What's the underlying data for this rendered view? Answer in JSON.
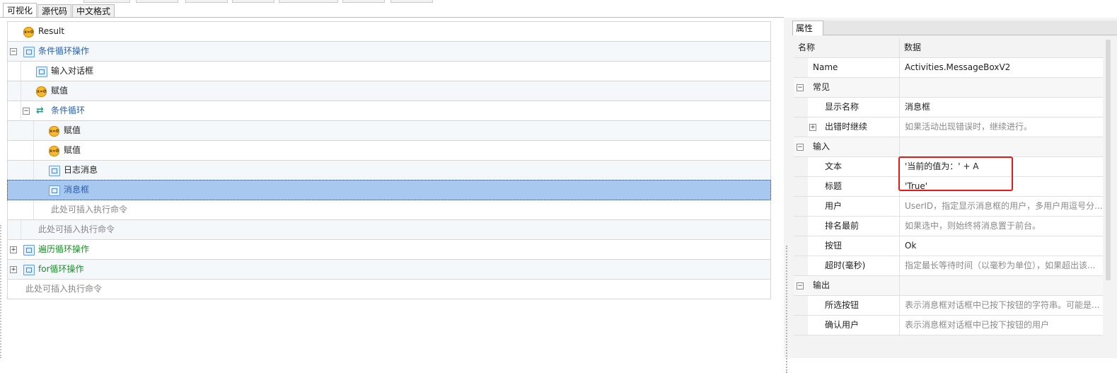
{
  "tabs": [
    "可视化",
    "源代码",
    "中文格式"
  ],
  "tree": {
    "result_label": "Result",
    "rows": [
      {
        "label": "Result",
        "kind": "var",
        "style": "dark"
      },
      {
        "label": "条件循环操作",
        "kind": "act",
        "style": "blue",
        "expander": "−"
      },
      {
        "label": "输入对话框",
        "kind": "act",
        "style": "dark"
      },
      {
        "label": "赋值",
        "kind": "var",
        "style": "dark"
      },
      {
        "label": "条件循环",
        "kind": "loop",
        "style": "blue",
        "expander": "−"
      },
      {
        "label": "赋值",
        "kind": "var",
        "style": "dark"
      },
      {
        "label": "赋值",
        "kind": "var",
        "style": "dark"
      },
      {
        "label": "日志消息",
        "kind": "act",
        "style": "dark"
      },
      {
        "label": "消息框",
        "kind": "act",
        "style": "blue",
        "selected": true
      },
      {
        "label": "此处可插入执行命令",
        "kind": "hint"
      },
      {
        "label": "此处可插入执行命令",
        "kind": "hint"
      },
      {
        "label": "遍历循环操作",
        "kind": "act",
        "style": "green",
        "expander": "+"
      },
      {
        "label": "for循环操作",
        "kind": "act",
        "style": "green",
        "expander": "+"
      },
      {
        "label": "此处可插入执行命令",
        "kind": "hint"
      }
    ]
  },
  "properties": {
    "tab_label": "属性",
    "header": {
      "name": "名称",
      "data": "数据"
    },
    "rows": [
      {
        "name": "Name",
        "value": "Activities.MessageBoxV2",
        "value_style": "dark"
      },
      {
        "category": "常见",
        "expander": "−"
      },
      {
        "name": "显示名称",
        "value": "消息框",
        "value_style": "dark"
      },
      {
        "name": "出错时继续",
        "value": "如果活动出现错误时，继续进行。",
        "value_style": "gray",
        "expander": "+"
      },
      {
        "category": "输入",
        "expander": "−"
      },
      {
        "name": "文本",
        "value": "'当前的值为：' + A",
        "value_style": "dark"
      },
      {
        "name": "标题",
        "value": "'True'",
        "value_style": "dark"
      },
      {
        "name": "用户",
        "value": "UserID，指定显示消息框的用户，多用户用逗号分...",
        "value_style": "gray"
      },
      {
        "name": "排名最前",
        "value": "如果选中，则始终将消息置于前台。",
        "value_style": "gray"
      },
      {
        "name": "按钮",
        "value": "Ok",
        "value_style": "dark"
      },
      {
        "name": "超时(毫秒)",
        "value": "指定最长等待时间（以毫秒为单位），如果超出该...",
        "value_style": "gray"
      },
      {
        "category": "输出",
        "expander": "−"
      },
      {
        "name": "所选按钮",
        "value": "表示消息框对话框中已按下按钮的字符串。可能是...",
        "value_style": "gray"
      },
      {
        "name": "确认用户",
        "value": "表示消息框对话框中已按下按钮的用户",
        "value_style": "gray"
      }
    ]
  },
  "colors": {
    "selected_row": "#a8c8f0",
    "highlight_border": "#e81818",
    "blue_text": "#2c5ea8",
    "green_text": "#1f8a2b"
  }
}
